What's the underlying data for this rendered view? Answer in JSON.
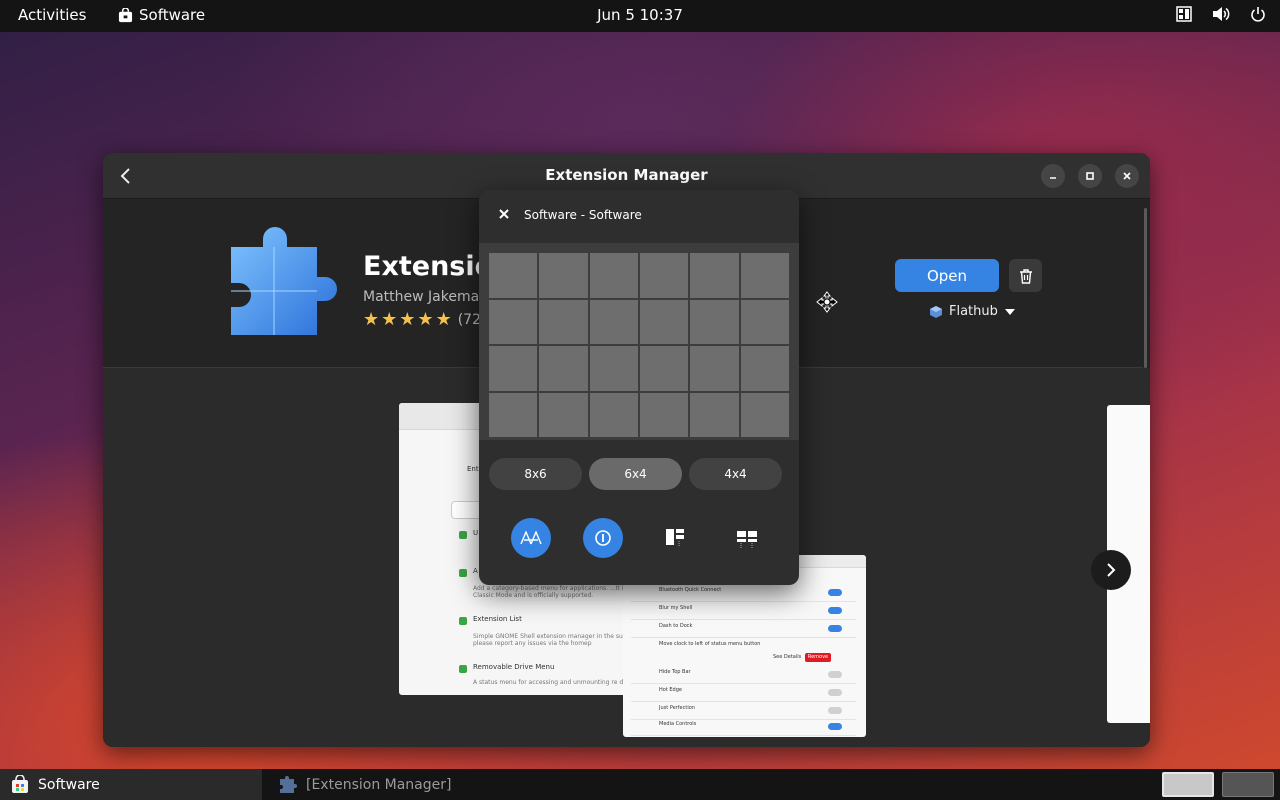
{
  "topbar": {
    "activities": "Activities",
    "app_menu": "Software",
    "clock": "Jun 5  10:37"
  },
  "window": {
    "title": "Extension Manager",
    "app": {
      "name": "Extension",
      "developer": "Matthew Jakeman",
      "rating_stars": 5,
      "rating_count": "(720",
      "open_label": "Open",
      "source": "Flathub"
    },
    "screenshot1": {
      "rows": [
        {
          "title": "Enti",
          "subtitle": ""
        },
        {
          "title": "U",
          "subtitle": "S"
        },
        {
          "title": "A",
          "subtitle": "Add a category-based menu for applications. ...It is part of Classic Mode and is officially supported."
        },
        {
          "title": "Extension List",
          "subtitle": "Simple GNOME Shell extension manager in the support, please report any issues via the homep"
        },
        {
          "title": "Removable Drive Menu",
          "subtitle": "A status menu for accessing and unmounting re devices."
        }
      ]
    },
    "screenshot2": {
      "rows": [
        "Bluetooth Quick Connect",
        "Blur my Shell",
        "Dash to Dock",
        "Move clock to left of status menu button",
        "Hide Top Bar",
        "Hot Edge",
        "Just Perfection",
        "Media Controls"
      ],
      "see_details": "See Details",
      "remove": "Remove"
    }
  },
  "popup": {
    "title": "Software - Software",
    "grid": {
      "cols": 6,
      "rows": 4
    },
    "layouts": [
      {
        "label": "8x6",
        "active": false
      },
      {
        "label": "6x4",
        "active": true
      },
      {
        "label": "4x4",
        "active": false
      }
    ],
    "modes": [
      "tiling-icon",
      "info-icon",
      "layout-left-icon",
      "layout-grid-icon"
    ]
  },
  "taskbar": {
    "tasks": [
      {
        "label": "Software",
        "active": true
      },
      {
        "label": "[Extension Manager]",
        "active": false
      }
    ],
    "workspaces": 2
  },
  "colors": {
    "accent": "#3584e4",
    "star": "#f6c14a",
    "window_bg": "#242424"
  }
}
